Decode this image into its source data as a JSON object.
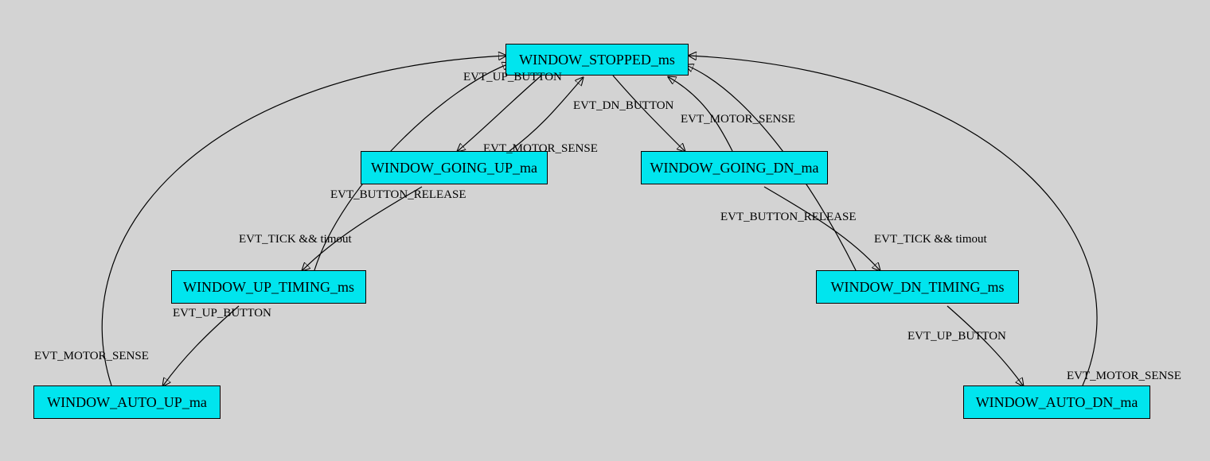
{
  "nodes": {
    "stopped": {
      "label": "WINDOW_STOPPED_ms"
    },
    "going_up": {
      "label": "WINDOW_GOING_UP_ma"
    },
    "going_dn": {
      "label": "WINDOW_GOING_DN_ma"
    },
    "up_timing": {
      "label": "WINDOW_UP_TIMING_ms"
    },
    "dn_timing": {
      "label": "WINDOW_DN_TIMING_ms"
    },
    "auto_up": {
      "label": "WINDOW_AUTO_UP_ma"
    },
    "auto_dn": {
      "label": "WINDOW_AUTO_DN_ma"
    }
  },
  "edges": {
    "stopped_to_going_up": {
      "label": "EVT_UP_BUTTON"
    },
    "stopped_to_going_dn": {
      "label": "EVT_DN_BUTTON"
    },
    "going_up_to_stopped": {
      "label": "EVT_MOTOR_SENSE"
    },
    "going_dn_to_stopped": {
      "label": "EVT_MOTOR_SENSE"
    },
    "going_up_to_up_timing": {
      "label": "EVT_BUTTON_RELEASE"
    },
    "going_dn_to_dn_timing": {
      "label": "EVT_BUTTON_RELEASE"
    },
    "up_timing_to_stopped": {
      "label": "EVT_TICK && timout"
    },
    "dn_timing_to_stopped": {
      "label": "EVT_TICK && timout"
    },
    "up_timing_to_auto_up": {
      "label": "EVT_UP_BUTTON"
    },
    "dn_timing_to_auto_dn": {
      "label": "EVT_UP_BUTTON"
    },
    "auto_up_to_stopped": {
      "label": "EVT_MOTOR_SENSE"
    },
    "auto_dn_to_stopped": {
      "label": "EVT_MOTOR_SENSE"
    }
  }
}
